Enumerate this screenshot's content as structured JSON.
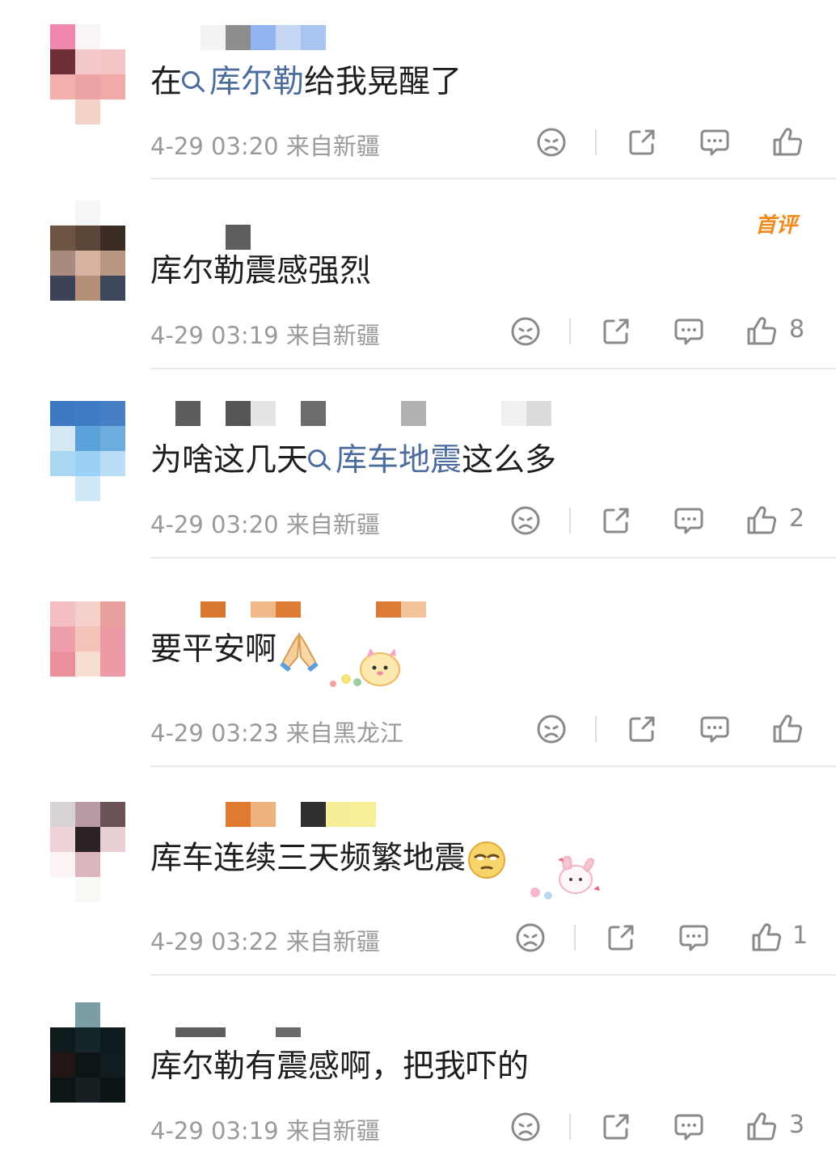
{
  "comments": [
    {
      "text_before": "在",
      "topic": "库尔勒",
      "text_after": "给我晃醒了",
      "time": "4-29 03:20",
      "location": "来自新疆",
      "likes": "",
      "badge": ""
    },
    {
      "text_before": "库尔勒震感强烈",
      "topic": "",
      "text_after": "",
      "time": "4-29 03:19",
      "location": "来自新疆",
      "likes": "8",
      "badge": "首评"
    },
    {
      "text_before": "为啥这几天",
      "topic": "库车地震",
      "text_after": "这么多",
      "time": "4-29 03:20",
      "location": "来自新疆",
      "likes": "2",
      "badge": ""
    },
    {
      "text_before": "要平安啊",
      "topic": "",
      "text_after": "",
      "emoji": "praying-hands-emoji",
      "time": "4-29 03:23",
      "location": "来自黑龙江",
      "likes": "",
      "badge": ""
    },
    {
      "text_before": "库车连续三天频繁地震",
      "topic": "",
      "text_after": "",
      "emoji": "eye-roll-emoji",
      "time": "4-29 03:22",
      "location": "来自新疆",
      "likes": "1",
      "badge": ""
    },
    {
      "text_before": "库尔勒有震感啊，把我吓的",
      "topic": "",
      "text_after": "",
      "time": "4-29 03:19",
      "location": "来自新疆",
      "likes": "3",
      "badge": ""
    }
  ],
  "icons": {
    "dislike": "sad-face-icon",
    "share": "share-icon",
    "reply": "comment-bubble-icon",
    "like": "thumbs-up-icon"
  },
  "colors": {
    "topic_link": "#4d6c9e",
    "meta_text": "#9a9a9a",
    "badge": "#f08a1c",
    "divider": "#e9e9e9"
  }
}
